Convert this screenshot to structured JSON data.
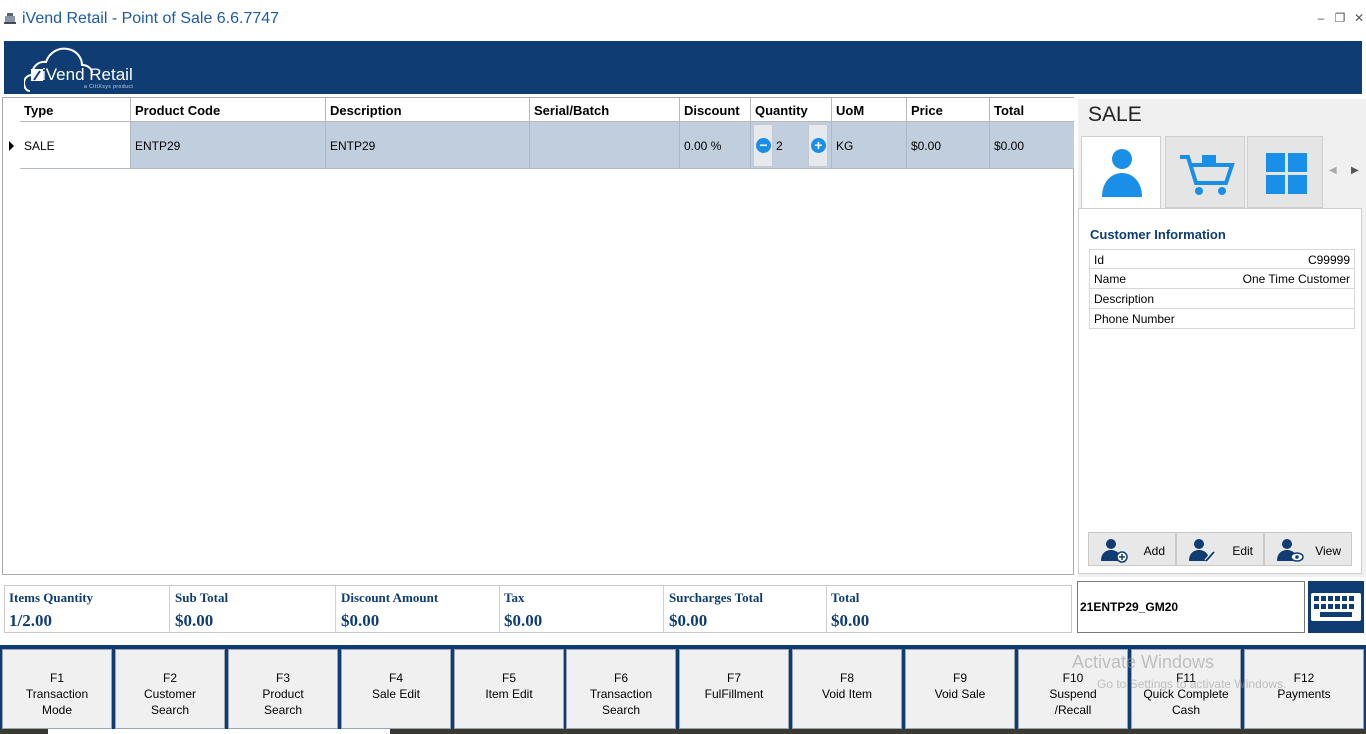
{
  "window": {
    "title": "iVend Retail - Point of Sale 6.6.7747"
  },
  "brand": {
    "logo_text": "iVend Retail",
    "logo_sub": "a CitiXsys product"
  },
  "grid": {
    "columns": [
      "Type",
      "Product Code",
      "Description",
      "Serial/Batch",
      "Discount",
      "Quantity",
      "UoM",
      "Price",
      "Total"
    ],
    "rows": [
      {
        "type": "SALE",
        "product_code": "ENTP29",
        "description": "ENTP29",
        "serial_batch": "",
        "discount": "0.00 %",
        "quantity": "2",
        "uom": "KG",
        "price": "$0.00",
        "total": "$0.00"
      }
    ]
  },
  "side": {
    "title": "SALE",
    "tabs": [
      {
        "name": "customer",
        "icon": "user-icon",
        "active": true
      },
      {
        "name": "cart",
        "icon": "shopping-cart-icon",
        "active": false
      },
      {
        "name": "apps",
        "icon": "grid-icon",
        "active": false
      }
    ],
    "customer_info": {
      "title": "Customer Information",
      "fields": [
        {
          "label": "Id",
          "value": "C99999"
        },
        {
          "label": "Name",
          "value": "One Time Customer"
        },
        {
          "label": "Description",
          "value": ""
        },
        {
          "label": "Phone Number",
          "value": ""
        }
      ]
    },
    "buttons": {
      "add": "Add",
      "edit": "Edit",
      "view": "View"
    }
  },
  "totals": [
    {
      "label": "Items Quantity",
      "value": "1/2.00"
    },
    {
      "label": "Sub Total",
      "value": "$0.00"
    },
    {
      "label": "Discount Amount",
      "value": "$0.00"
    },
    {
      "label": "Tax",
      "value": "$0.00"
    },
    {
      "label": "Surcharges Total",
      "value": "$0.00"
    },
    {
      "label": "Total",
      "value": "$0.00"
    }
  ],
  "scan": {
    "value": "21ENTP29_GM20"
  },
  "fkeys": [
    {
      "key": "F1",
      "label": "Transaction\nMode"
    },
    {
      "key": "F2",
      "label": "Customer\nSearch"
    },
    {
      "key": "F3",
      "label": "Product\nSearch"
    },
    {
      "key": "F4",
      "label": "Sale Edit"
    },
    {
      "key": "F5",
      "label": "Item Edit"
    },
    {
      "key": "F6",
      "label": "Transaction\nSearch"
    },
    {
      "key": "F7",
      "label": "FulFillment"
    },
    {
      "key": "F8",
      "label": "Void Item"
    },
    {
      "key": "F9",
      "label": "Void Sale"
    },
    {
      "key": "F10",
      "label": "Suspend\n/Recall"
    },
    {
      "key": "F11",
      "label": "Quick Complete\nCash"
    },
    {
      "key": "F12",
      "label": "Payments"
    }
  ],
  "watermark": {
    "title": "Activate Windows",
    "sub": "Go to Settings to activate Windows."
  },
  "colors": {
    "brand": "#0f3d73",
    "row_selected": "#c1cede",
    "accent_blue": "#1a8fe8",
    "title_blue": "#1d5aa8"
  }
}
